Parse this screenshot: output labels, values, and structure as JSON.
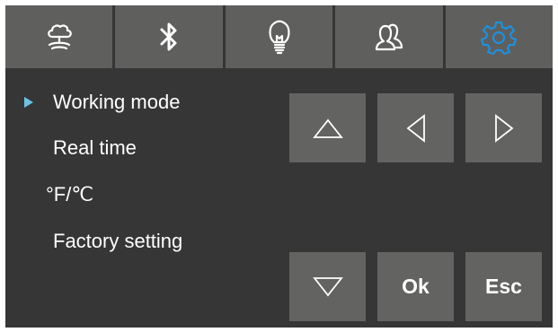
{
  "tabs": [
    {
      "icon": "cloud-tree-icon",
      "active": false
    },
    {
      "icon": "bluetooth-icon",
      "active": false
    },
    {
      "icon": "lightbulb-icon",
      "active": false
    },
    {
      "icon": "users-icon",
      "active": false
    },
    {
      "icon": "gear-icon",
      "active": true
    }
  ],
  "menu": {
    "items": [
      {
        "label": "Working mode",
        "selected": true
      },
      {
        "label": "Real time",
        "selected": false
      },
      {
        "label": "°F/℃",
        "selected": false
      },
      {
        "label": "Factory setting",
        "selected": false
      }
    ]
  },
  "keypad": {
    "up_icon": "triangle-up-icon",
    "left_icon": "triangle-left-icon",
    "right_icon": "triangle-right-icon",
    "down_icon": "triangle-down-icon",
    "ok_label": "Ok",
    "esc_label": "Esc"
  },
  "colors": {
    "background": "#363636",
    "tab": "#5f5f5e",
    "key": "#636362",
    "accent": "#1e90dc",
    "marker": "#6cc3e6",
    "text": "#ffffff"
  }
}
